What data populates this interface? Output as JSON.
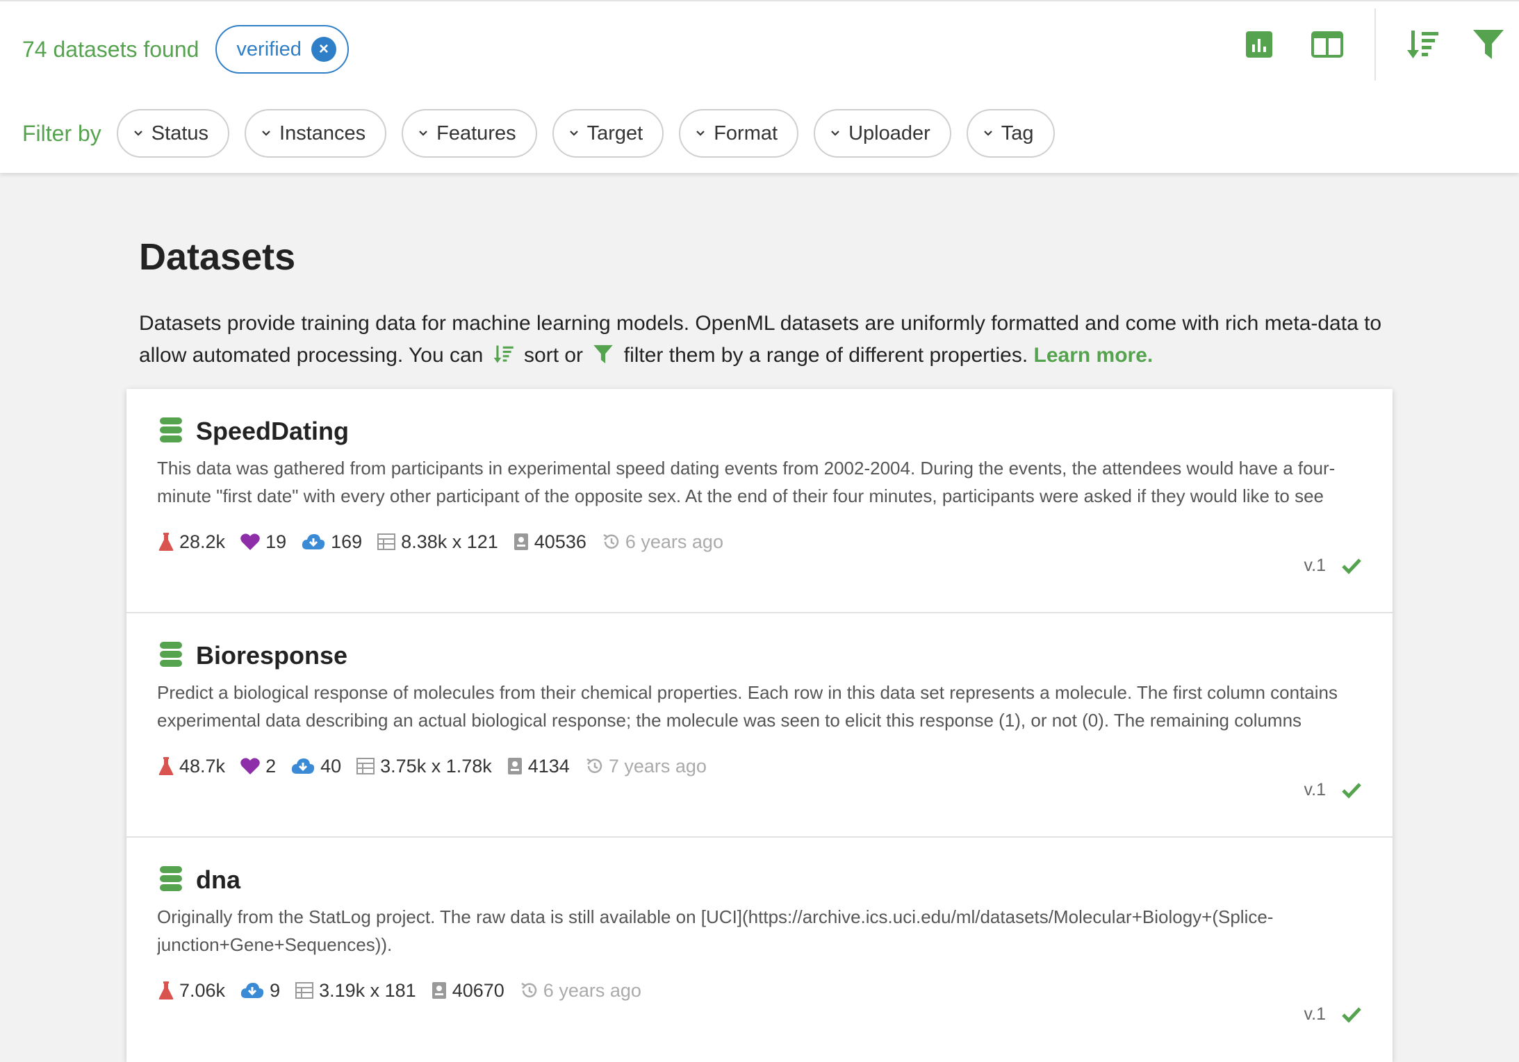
{
  "header": {
    "results_count": "74 datasets found",
    "active_filter": {
      "label": "verified",
      "remove_icon": "close-circle-icon"
    },
    "tools": [
      {
        "name": "chart-icon"
      },
      {
        "name": "table-icon"
      },
      {
        "name": "sort-icon"
      },
      {
        "name": "filter-icon"
      }
    ],
    "filter_label": "Filter by",
    "filters": [
      "Status",
      "Instances",
      "Features",
      "Target",
      "Format",
      "Uploader",
      "Tag"
    ]
  },
  "main": {
    "title": "Datasets",
    "intro_before_sort": "Datasets provide training data for machine learning models. OpenML datasets are uniformly formatted and come with rich meta-data to allow automated processing. You can",
    "intro_sort": "sort or",
    "intro_filter": "filter them by a range of different properties.",
    "learn_more": "Learn more."
  },
  "datasets": [
    {
      "name": "SpeedDating",
      "description": "This data was gathered from participants in experimental speed dating events from 2002-2004. During the events, the attendees would have a four-minute \"first date\" with every other participant of the opposite sex. At the end of their four minutes, participants were asked if they would like to see",
      "runs": "28.2k",
      "likes": "19",
      "downloads": "169",
      "size": "8.38k x 121",
      "id": "40536",
      "age": "6 years ago",
      "version": "v.1"
    },
    {
      "name": "Bioresponse",
      "description": "Predict a biological response of molecules from their chemical properties. Each row in this data set represents a molecule. The first column contains experimental data describing an actual biological response; the molecule was seen to elicit this response (1), or not (0). The remaining columns",
      "runs": "48.7k",
      "likes": "2",
      "downloads": "40",
      "size": "3.75k x 1.78k",
      "id": "4134",
      "age": "7 years ago",
      "version": "v.1"
    },
    {
      "name": "dna",
      "description": "Originally from the StatLog project. The raw data is still available on [UCI](https://archive.ics.uci.edu/ml/datasets/Molecular+Biology+(Splice-junction+Gene+Sequences)).",
      "runs": "7.06k",
      "likes": "",
      "downloads": "9",
      "size": "3.19k x 181",
      "id": "40670",
      "age": "6 years ago",
      "version": "v.1"
    }
  ],
  "colors": {
    "accent_green": "#55a34f",
    "chip_blue": "#2f7fc8",
    "runs_red": "#d9534f",
    "likes_purple": "#8e2ea8",
    "downloads_blue": "#3a8ad6"
  }
}
